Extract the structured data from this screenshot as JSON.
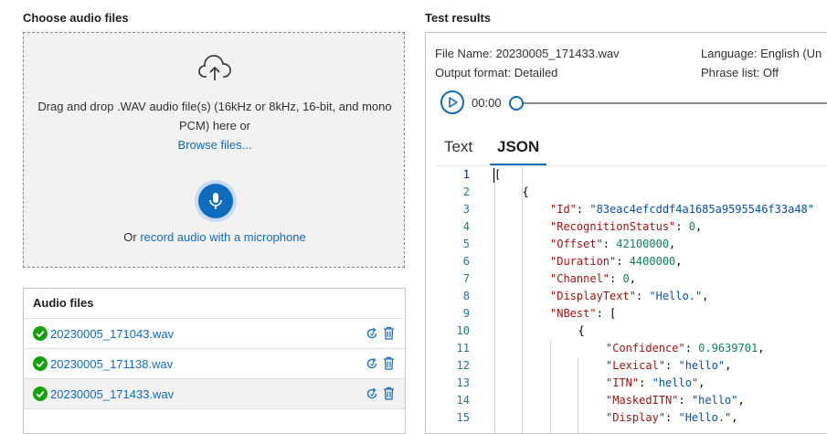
{
  "left": {
    "title": "Choose audio files",
    "dropzone": {
      "text": "Drag and drop .WAV audio file(s) (16kHz or 8kHz, 16-bit, and mono PCM) here or",
      "browse_label": "Browse files...",
      "record_prefix": "Or ",
      "record_link": "record audio with a microphone",
      "icon": "cloud-upload-icon",
      "mic_icon": "microphone-icon"
    },
    "audio_files": {
      "header": "Audio files",
      "items": [
        {
          "name": "20230005_171043.wav",
          "status_icon": "check-circle-icon",
          "selected": false
        },
        {
          "name": "20230005_171138.wav",
          "status_icon": "check-circle-icon",
          "selected": false
        },
        {
          "name": "20230005_171433.wav",
          "status_icon": "check-circle-icon",
          "selected": true
        }
      ]
    }
  },
  "right": {
    "title": "Test results",
    "file_name_label": "File Name: 20230005_171433.wav",
    "output_format_label": "Output format: Detailed",
    "language_label": "Language: English (Un",
    "phrase_list_label": "Phrase list: Off",
    "player": {
      "time": "00:00",
      "progress": 0
    },
    "tabs": [
      {
        "label": "Text",
        "active": false
      },
      {
        "label": "JSON",
        "active": true
      }
    ],
    "code_lines": [
      {
        "n": "1",
        "indent": 0,
        "parts": [
          [
            "p",
            "["
          ]
        ]
      },
      {
        "n": "2",
        "indent": 1,
        "parts": [
          [
            "p",
            "{"
          ]
        ]
      },
      {
        "n": "3",
        "indent": 2,
        "parts": [
          [
            "k",
            "\"Id\""
          ],
          [
            "p",
            ": "
          ],
          [
            "s",
            "\"83eac4efcddf4a1685a9595546f33a48\""
          ]
        ]
      },
      {
        "n": "4",
        "indent": 2,
        "parts": [
          [
            "k",
            "\"RecognitionStatus\""
          ],
          [
            "p",
            ": "
          ],
          [
            "n",
            "0"
          ],
          [
            "p",
            ","
          ]
        ]
      },
      {
        "n": "5",
        "indent": 2,
        "parts": [
          [
            "k",
            "\"Offset\""
          ],
          [
            "p",
            ": "
          ],
          [
            "n",
            "42100000"
          ],
          [
            "p",
            ","
          ]
        ]
      },
      {
        "n": "6",
        "indent": 2,
        "parts": [
          [
            "k",
            "\"Duration\""
          ],
          [
            "p",
            ": "
          ],
          [
            "n",
            "4400000"
          ],
          [
            "p",
            ","
          ]
        ]
      },
      {
        "n": "7",
        "indent": 2,
        "parts": [
          [
            "k",
            "\"Channel\""
          ],
          [
            "p",
            ": "
          ],
          [
            "n",
            "0"
          ],
          [
            "p",
            ","
          ]
        ]
      },
      {
        "n": "8",
        "indent": 2,
        "parts": [
          [
            "k",
            "\"DisplayText\""
          ],
          [
            "p",
            ": "
          ],
          [
            "s",
            "\"Hello.\""
          ],
          [
            "p",
            ","
          ]
        ]
      },
      {
        "n": "9",
        "indent": 2,
        "parts": [
          [
            "k",
            "\"NBest\""
          ],
          [
            "p",
            ": ["
          ]
        ]
      },
      {
        "n": "10",
        "indent": 3,
        "parts": [
          [
            "p",
            "{"
          ]
        ]
      },
      {
        "n": "11",
        "indent": 4,
        "parts": [
          [
            "k",
            "\"Confidence\""
          ],
          [
            "p",
            ": "
          ],
          [
            "n",
            "0.9639701"
          ],
          [
            "p",
            ","
          ]
        ]
      },
      {
        "n": "12",
        "indent": 4,
        "parts": [
          [
            "k",
            "\"Lexical\""
          ],
          [
            "p",
            ": "
          ],
          [
            "s",
            "\"hello\""
          ],
          [
            "p",
            ","
          ]
        ]
      },
      {
        "n": "13",
        "indent": 4,
        "parts": [
          [
            "k",
            "\"ITN\""
          ],
          [
            "p",
            ": "
          ],
          [
            "s",
            "\"hello\""
          ],
          [
            "p",
            ","
          ]
        ]
      },
      {
        "n": "14",
        "indent": 4,
        "parts": [
          [
            "k",
            "\"MaskedITN\""
          ],
          [
            "p",
            ": "
          ],
          [
            "s",
            "\"hello\""
          ],
          [
            "p",
            ","
          ]
        ]
      },
      {
        "n": "15",
        "indent": 4,
        "parts": [
          [
            "k",
            "\"Display\""
          ],
          [
            "p",
            ": "
          ],
          [
            "s",
            "\"Hello.\""
          ],
          [
            "p",
            ","
          ]
        ]
      }
    ]
  },
  "colors": {
    "accent": "#0f6cbd",
    "success": "#13a10e",
    "key": "#a31515",
    "string": "#0451a5",
    "number": "#098658"
  }
}
